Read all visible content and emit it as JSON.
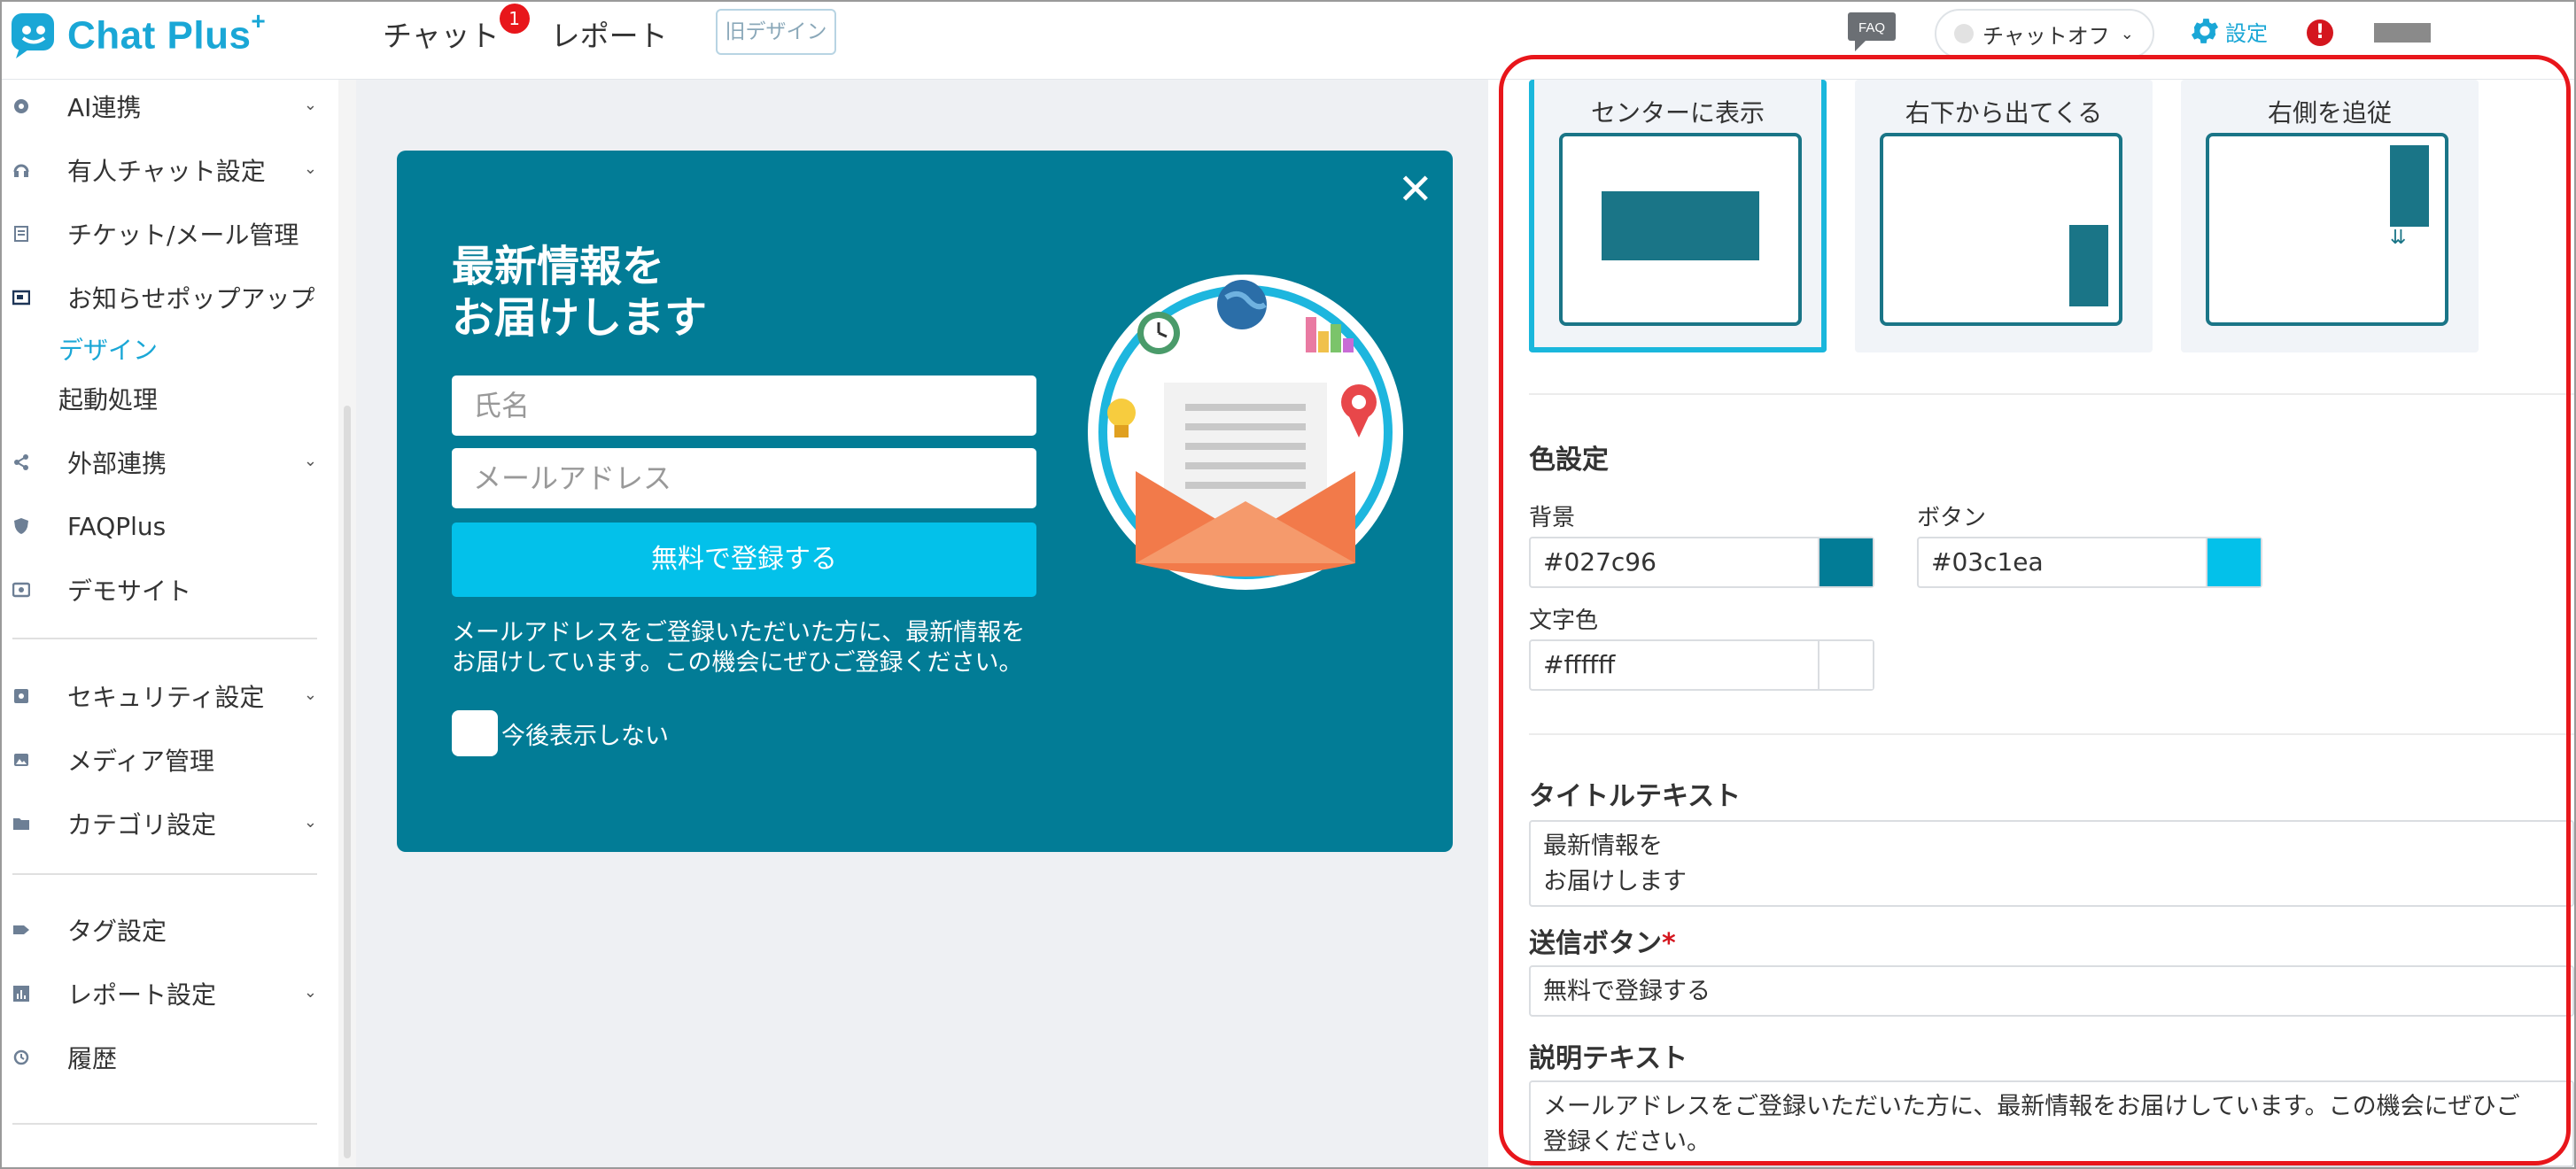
{
  "app": {
    "logo_text": "Chat Plus",
    "logo_sup": "+",
    "brand_color": "#1aa7d6"
  },
  "header": {
    "nav": [
      {
        "label": "チャット",
        "badge": "1"
      },
      {
        "label": "レポート"
      }
    ],
    "old_design_label": "旧デザイン",
    "faq_label": "FAQ",
    "status_label": "チャットオフ",
    "settings_label": "設定",
    "alert_label": "!"
  },
  "sidebar": {
    "items": [
      {
        "label": "AI連携",
        "icon": "ai-icon",
        "chevron": true
      },
      {
        "label": "有人チャット設定",
        "icon": "headset-icon",
        "chevron": true
      },
      {
        "label": "チケット/メール管理",
        "icon": "ticket-icon",
        "chevron": false
      },
      {
        "label": "お知らせポップアップ",
        "icon": "popup-icon",
        "chevron": true
      },
      {
        "label": "外部連携",
        "icon": "share-icon",
        "chevron": true
      },
      {
        "label": "FAQPlus",
        "icon": "faq-shield-icon",
        "chevron": false
      },
      {
        "label": "デモサイト",
        "icon": "demo-icon",
        "chevron": false
      },
      {
        "label": "セキュリティ設定",
        "icon": "security-icon",
        "chevron": true
      },
      {
        "label": "メディア管理",
        "icon": "media-icon",
        "chevron": false
      },
      {
        "label": "カテゴリ設定",
        "icon": "folder-icon",
        "chevron": true
      },
      {
        "label": "タグ設定",
        "icon": "tag-icon",
        "chevron": false
      },
      {
        "label": "レポート設定",
        "icon": "chart-icon",
        "chevron": true
      },
      {
        "label": "履歴",
        "icon": "history-icon",
        "chevron": false
      }
    ],
    "subitems": [
      {
        "label": "デザイン",
        "active": true
      },
      {
        "label": "起動処理",
        "active": false
      }
    ]
  },
  "popup": {
    "title": "最新情報を\nお届けします",
    "name_placeholder": "氏名",
    "email_placeholder": "メールアドレス",
    "button_label": "無料で登録する",
    "description": "メールアドレスをご登録いただいた方に、最新情報を\nお届けしています。この機会にぜひご登録ください。",
    "checkbox_label": "今後表示しない",
    "close_label": "✕",
    "bg_color": "#027c96",
    "button_color": "#03c1ea"
  },
  "panel": {
    "positions": [
      {
        "label": "センターに表示",
        "selected": true
      },
      {
        "label": "右下から出てくる",
        "selected": false
      },
      {
        "label": "右側を追従",
        "selected": false
      }
    ],
    "color_section_title": "色設定",
    "colors": {
      "background": {
        "label": "背景",
        "value": "#027c96"
      },
      "button": {
        "label": "ボタン",
        "value": "#03c1ea"
      },
      "text": {
        "label": "文字色",
        "value": "#ffffff"
      }
    },
    "title_text_label": "タイトルテキスト",
    "title_text_value": "最新情報を\nお届けします",
    "submit_label": "送信ボタン",
    "submit_required": "*",
    "submit_value": "無料で登録する",
    "desc_label": "説明テキスト",
    "desc_value": "メールアドレスをご登録いただいた方に、最新情報をお届けしています。この機会にぜひご\n登録ください。"
  }
}
